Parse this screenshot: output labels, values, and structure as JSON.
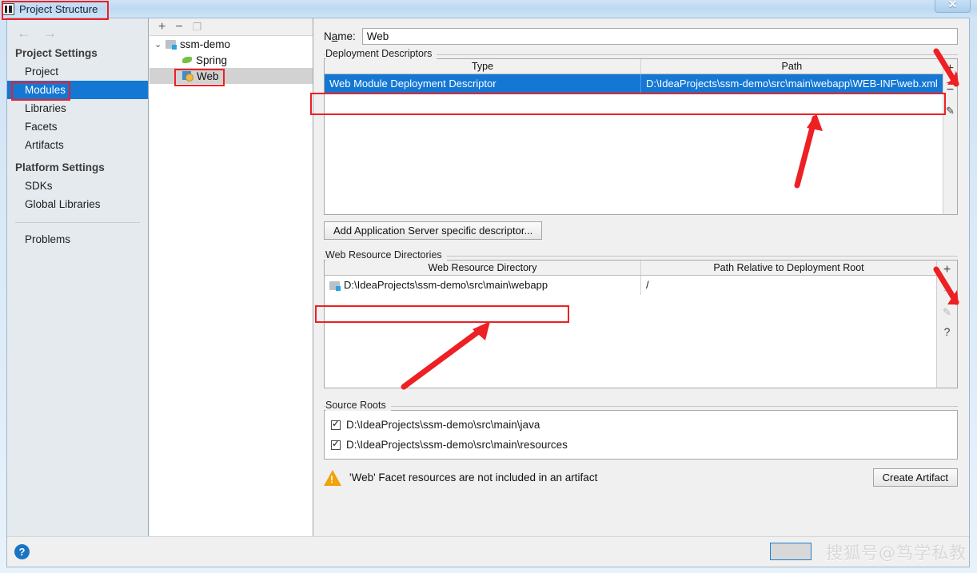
{
  "window": {
    "title": "Project Structure",
    "app_icon": "intellij-idea-icon",
    "close_label": "✕"
  },
  "sidebar": {
    "nav": {
      "back": "←",
      "forward": "→"
    },
    "groups": [
      {
        "title": "Project Settings",
        "items": [
          {
            "label": "Project",
            "selected": false
          },
          {
            "label": "Modules",
            "selected": true
          },
          {
            "label": "Libraries",
            "selected": false
          },
          {
            "label": "Facets",
            "selected": false
          },
          {
            "label": "Artifacts",
            "selected": false
          }
        ]
      },
      {
        "title": "Platform Settings",
        "items": [
          {
            "label": "SDKs",
            "selected": false
          },
          {
            "label": "Global Libraries",
            "selected": false
          }
        ]
      }
    ],
    "extra_items": [
      {
        "label": "Problems",
        "selected": false
      }
    ]
  },
  "tree": {
    "toolbar": [
      {
        "name": "add-module-button",
        "glyph": "+",
        "enabled": true
      },
      {
        "name": "remove-module-button",
        "glyph": "−",
        "enabled": true
      },
      {
        "name": "copy-module-button",
        "glyph": "❐",
        "enabled": false
      }
    ],
    "nodes": [
      {
        "label": "ssm-demo",
        "icon": "module-folder-icon",
        "depth": 0,
        "expanded": true,
        "selected": false
      },
      {
        "label": "Spring",
        "icon": "spring-leaf-icon",
        "depth": 1,
        "expanded": null,
        "selected": false
      },
      {
        "label": "Web",
        "icon": "web-facet-icon",
        "depth": 1,
        "expanded": null,
        "selected": true
      }
    ]
  },
  "content": {
    "name_field": {
      "label_pre": "N",
      "label_mnemonic": "a",
      "label_post": "me:",
      "value": "Web",
      "placeholder": ""
    },
    "deployment_descriptors": {
      "title": "Deployment Descriptors",
      "columns": [
        "Type",
        "Path"
      ],
      "rows": [
        {
          "type": "Web Module Deployment Descriptor",
          "path": "D:\\IdeaProjects\\ssm-demo\\src\\main\\webapp\\WEB-INF\\web.xml",
          "selected": true
        }
      ],
      "buttons": [
        {
          "name": "add-descriptor-button",
          "glyph": "+",
          "enabled": true
        },
        {
          "name": "remove-descriptor-button",
          "glyph": "−",
          "enabled": true
        },
        {
          "name": "edit-descriptor-button",
          "glyph": "✎",
          "enabled": true
        }
      ],
      "add_server_descriptor_label": "Add Application Server specific descriptor..."
    },
    "web_resource_directories": {
      "title": "Web Resource Directories",
      "columns": [
        "Web Resource Directory",
        "Path Relative to Deployment Root"
      ],
      "rows": [
        {
          "directory": "D:\\IdeaProjects\\ssm-demo\\src\\main\\webapp",
          "relative_path": "/",
          "icon": "folder-icon"
        }
      ],
      "buttons": [
        {
          "name": "add-web-resource-button",
          "glyph": "+",
          "enabled": true
        },
        {
          "name": "remove-web-resource-button",
          "glyph": "−",
          "enabled": false
        },
        {
          "name": "edit-web-resource-button",
          "glyph": "✎",
          "enabled": false
        },
        {
          "name": "help-web-resource-button",
          "glyph": "?",
          "enabled": true
        }
      ]
    },
    "source_roots": {
      "title": "Source Roots",
      "rows": [
        {
          "label": "D:\\IdeaProjects\\ssm-demo\\src\\main\\java",
          "checked": true
        },
        {
          "label": "D:\\IdeaProjects\\ssm-demo\\src\\main\\resources",
          "checked": true
        }
      ]
    },
    "warning": {
      "icon": "warning-triangle-icon",
      "text": "'Web' Facet resources are not included in an artifact",
      "action_label": "Create Artifact"
    }
  },
  "footer": {
    "help_label": "?"
  },
  "watermark": {
    "text": "搜狐号@笃学私教"
  },
  "colors": {
    "selection_blue": "#1477d4",
    "annotation_red": "#ed2024",
    "warning_orange": "#f0a30a",
    "sidebar_bg": "#e5eaee",
    "dialog_bg": "#f0f0f0"
  }
}
